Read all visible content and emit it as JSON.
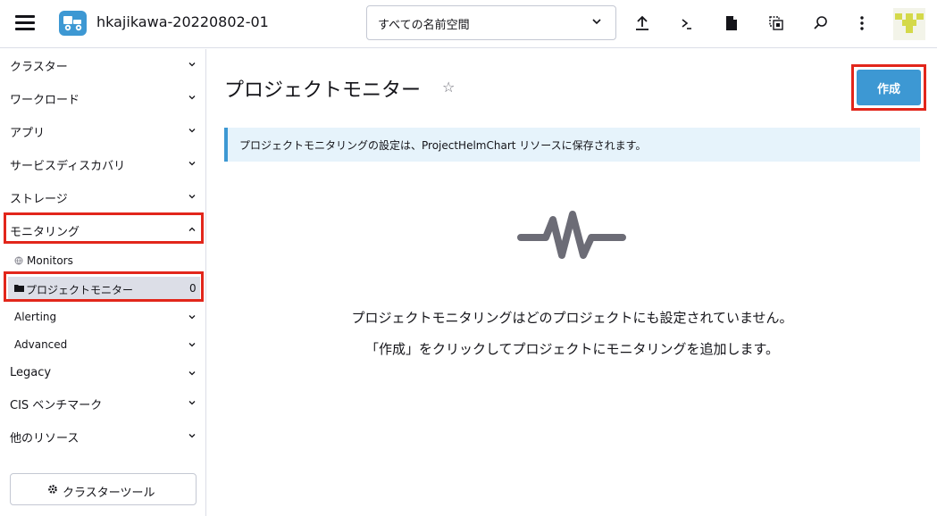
{
  "header": {
    "cluster_name": "hkajikawa-20220802-01",
    "namespace_selected": "すべての名前空間",
    "icons": [
      "menu-icon",
      "cluster-icon",
      "upload-icon",
      "shell-icon",
      "file-icon",
      "copy-icon",
      "search-icon",
      "more-icon",
      "avatar-icon"
    ]
  },
  "sidebar": {
    "groups": {
      "cluster": "クラスター",
      "workload": "ワークロード",
      "apps": "アプリ",
      "service_discovery": "サービスディスカバリ",
      "storage": "ストレージ",
      "monitoring": "モニタリング",
      "legacy": "Legacy",
      "cis": "CIS ベンチマーク",
      "other": "他のリソース"
    },
    "monitoring_items": {
      "monitors": "Monitors",
      "project_monitor": "プロジェクトモニター",
      "project_monitor_count": "0",
      "alerting": "Alerting",
      "advanced": "Advanced"
    },
    "cluster_tools": "クラスターツール"
  },
  "main": {
    "title": "プロジェクトモニター",
    "create_label": "作成",
    "banner_text": "プロジェクトモニタリングの設定は、ProjectHelmChart リソースに保存されます。",
    "empty_line1": "プロジェクトモニタリングはどのプロジェクトにも設定されていません。",
    "empty_line2": "「作成」をクリックしてプロジェクトにモニタリングを追加します。"
  },
  "colors": {
    "accent": "#3d98d3",
    "highlight": "#e2261b",
    "active_bg": "#dcdee7",
    "banner_bg": "#e6f3fb",
    "empty_icon": "#6c6c76"
  }
}
